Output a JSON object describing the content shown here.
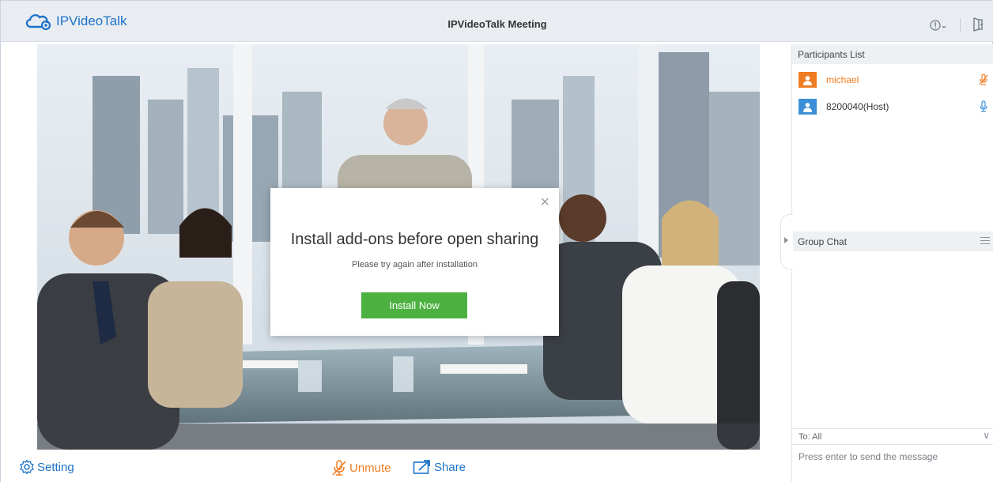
{
  "header": {
    "logo_text": "IPVideoTalk",
    "title": "IPVideoTalk Meeting",
    "info_icon": "info-icon",
    "exit_icon": "exit-icon"
  },
  "modal": {
    "title": "Install add-ons before open sharing",
    "subtitle": "Please try again after installation",
    "install_label": "Install Now",
    "close_glyph": "×"
  },
  "toolbar": {
    "setting_label": "Setting",
    "unmute_label": "Unmute",
    "share_label": "Share"
  },
  "participants": {
    "header": "Participants List",
    "items": [
      {
        "name": "michael",
        "color": "#f07c21",
        "mic": "muted"
      },
      {
        "name": "8200040(Host)",
        "color": "#3c8fd6",
        "mic": "active"
      }
    ]
  },
  "chat": {
    "header": "Group Chat",
    "to_label": "To: All",
    "input_placeholder": "Press enter to send the message"
  },
  "colors": {
    "brand_blue": "#1d73c9",
    "install_green": "#4db141",
    "unmute_orange": "#f07c21"
  }
}
